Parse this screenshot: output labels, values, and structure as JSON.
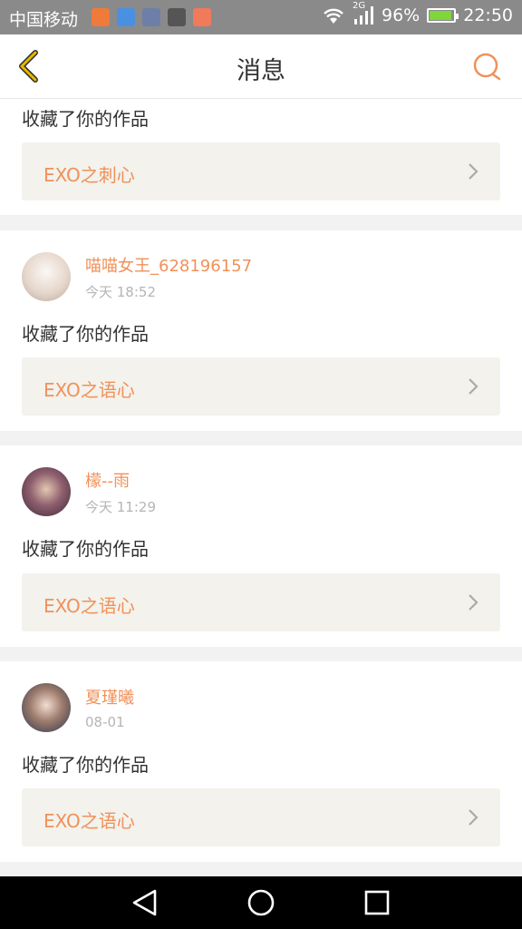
{
  "status_bar": {
    "carrier": "中国移动",
    "network": "2G",
    "battery": "96%",
    "time": "22:50"
  },
  "header": {
    "title": "消息",
    "back_icon": "chevron-left-icon",
    "search_icon": "search-icon"
  },
  "messages": [
    {
      "action": "收藏了你的作品",
      "work_title": "EXO之刺心"
    },
    {
      "user": "喵喵女王_628196157",
      "time": "今天 18:52",
      "action": "收藏了你的作品",
      "work_title": "EXO之语心"
    },
    {
      "user": "檬--雨",
      "time": "今天 11:29",
      "action": "收藏了你的作品",
      "work_title": "EXO之语心"
    },
    {
      "user": "夏瑾曦",
      "time": "08-01",
      "action": "收藏了你的作品",
      "work_title": "EXO之语心"
    }
  ],
  "colors": {
    "accent": "#f0915a",
    "header_icon": "#e6b800",
    "work_bg": "#f3f2ec"
  }
}
